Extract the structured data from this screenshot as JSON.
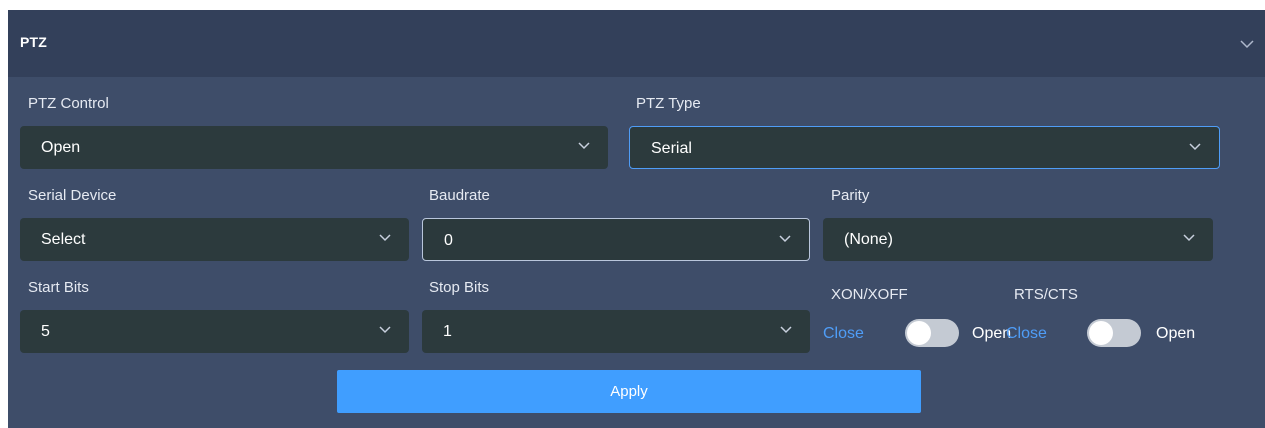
{
  "panel": {
    "title": "PTZ"
  },
  "fields": {
    "ptz_control": {
      "label": "PTZ Control",
      "value": "Open"
    },
    "ptz_type": {
      "label": "PTZ Type",
      "value": "Serial"
    },
    "serial_device": {
      "label": "Serial Device",
      "value": "Select"
    },
    "baudrate": {
      "label": "Baudrate",
      "value": "0"
    },
    "parity": {
      "label": "Parity",
      "value": "(None)"
    },
    "start_bits": {
      "label": "Start Bits",
      "value": "5"
    },
    "stop_bits": {
      "label": "Stop Bits",
      "value": "1"
    }
  },
  "toggles": {
    "xon_xoff": {
      "label": "XON/XOFF",
      "off_label": "Close",
      "on_label": "Open",
      "state": "off"
    },
    "rts_cts": {
      "label": "RTS/CTS",
      "off_label": "Close",
      "on_label": "Open",
      "state": "off"
    }
  },
  "apply_label": "Apply",
  "colors": {
    "header_bg": "#33405a",
    "panel_bg": "#3e4d69",
    "select_bg": "#2c3a3d",
    "accent": "#409eff",
    "switch_off": "#c4cad3"
  },
  "icons": {
    "collapse": "chevron-down-icon",
    "select_arrow": "chevron-down-icon"
  }
}
